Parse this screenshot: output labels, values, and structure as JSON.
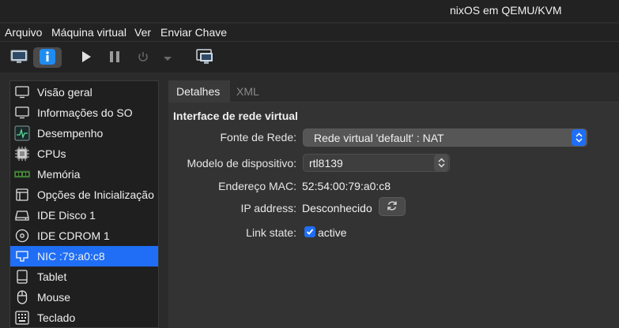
{
  "window": {
    "title": "nixOS em QEMU/KVM"
  },
  "menubar": {
    "items": [
      "Arquivo",
      "Máquina virtual",
      "Ver",
      "Enviar Chave"
    ]
  },
  "toolbar": {
    "buttons": [
      "monitor-icon",
      "info-icon",
      "play-icon",
      "pause-icon",
      "power-icon",
      "dropdown-arrow-icon",
      "screenshot-icon"
    ],
    "accent": "#1f8cf0"
  },
  "sidebar": {
    "items": [
      {
        "label": "Visão geral",
        "icon": "monitor-icon"
      },
      {
        "label": "Informações do SO",
        "icon": "monitor-icon"
      },
      {
        "label": "Desempenho",
        "icon": "performance-icon"
      },
      {
        "label": "CPUs",
        "icon": "cpu-icon"
      },
      {
        "label": "Memória",
        "icon": "memory-icon"
      },
      {
        "label": "Opções de Inicialização",
        "icon": "boot-icon"
      },
      {
        "label": "IDE Disco 1",
        "icon": "disk-icon"
      },
      {
        "label": "IDE CDROM 1",
        "icon": "cdrom-icon"
      },
      {
        "label": "NIC :79:a0:c8",
        "icon": "nic-icon",
        "selected": true
      },
      {
        "label": "Tablet",
        "icon": "tablet-icon"
      },
      {
        "label": "Mouse",
        "icon": "mouse-icon"
      },
      {
        "label": "Teclado",
        "icon": "keyboard-icon"
      }
    ],
    "selected_color": "#1f6ef5"
  },
  "tabs": [
    {
      "label": "Detalhes",
      "active": true
    },
    {
      "label": "XML",
      "active": false
    }
  ],
  "details": {
    "section_title": "Interface de rede virtual",
    "network_source": {
      "label": "Fonte de Rede:",
      "value": "Rede virtual 'default' : NAT"
    },
    "device_model": {
      "label": "Modelo de dispositivo:",
      "value": "rtl8139"
    },
    "mac_address": {
      "label": "Endereço MAC:",
      "value": "52:54:00:79:a0:c8"
    },
    "ip_address": {
      "label": "IP address:",
      "value": "Desconhecido"
    },
    "link_state": {
      "label": "Link state:",
      "checkbox_label": "active",
      "checked": true
    }
  }
}
